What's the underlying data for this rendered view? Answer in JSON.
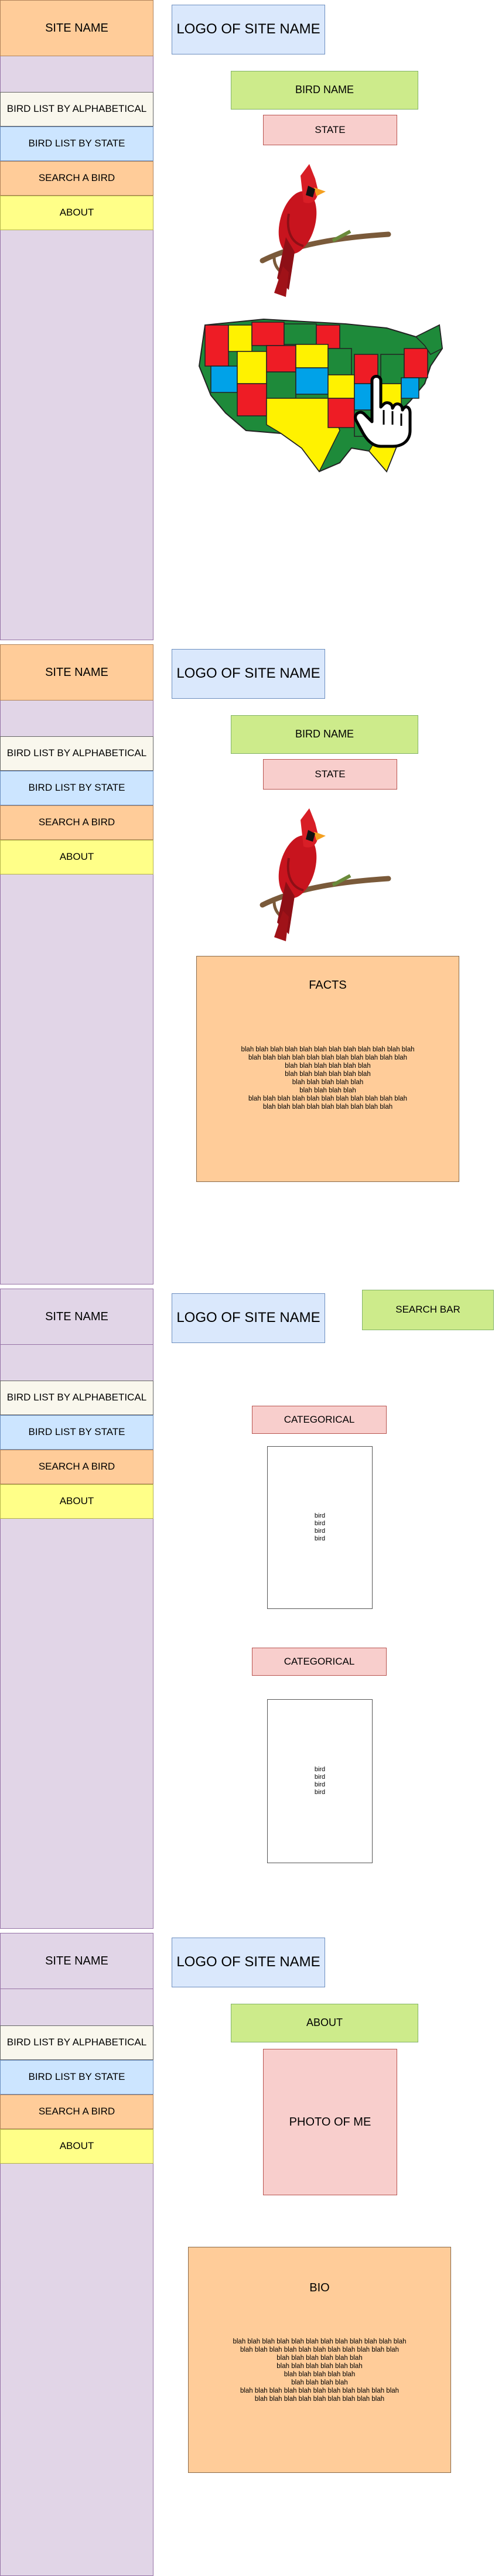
{
  "colors": {
    "sidebar": "#e1d5e7",
    "site_name_box": "#ffcc99",
    "logo_box": "#dae8fc",
    "green_box": "#cdeb8b",
    "pink_box": "#f8cecc",
    "facts_box": "#ffcc99"
  },
  "nav": {
    "alphabetical": "BIRD LIST BY ALPHABETICAL",
    "by_state": "BIRD LIST BY STATE",
    "search": "SEARCH A BIRD",
    "about": "ABOUT"
  },
  "site_name": "SITE NAME",
  "logo": "LOGO OF SITE NAME",
  "page1": {
    "bird_name": "BIRD NAME",
    "state": "STATE",
    "bird_image": "cardinal-icon",
    "map_image": "us-map-icon",
    "cursor": "hand-pointer-icon"
  },
  "page2": {
    "bird_name": "BIRD NAME",
    "state": "STATE",
    "facts_title": "FACTS",
    "facts_lines": [
      "blah blah blah blah blah blah blah blah blah blah blah blah",
      "blah blah blah blah blah blah blah blah blah blah blah",
      "blah blah blah blah blah blah",
      "blah blah blah blah blah blah",
      "blah blah blah blah blah",
      "blah blah blah blah",
      "blah blah blah blah blah blah blah blah blah blah blah",
      "blah blah blah blah blah blah blah blah blah"
    ]
  },
  "page3": {
    "search_bar": "SEARCH BAR",
    "categories": [
      {
        "label": "CATEGORICAL",
        "items": [
          "bird",
          "bird",
          "bird",
          "bird"
        ]
      },
      {
        "label": "CATEGORICAL",
        "items": [
          "bird",
          "bird",
          "bird",
          "bird"
        ]
      }
    ]
  },
  "page4": {
    "about": "ABOUT",
    "photo": "PHOTO OF ME",
    "bio_title": "BIO",
    "bio_lines": [
      "blah blah blah blah blah blah blah blah blah blah blah blah",
      "blah blah blah blah blah blah blah blah blah blah blah",
      "blah blah blah blah blah blah",
      "blah blah blah blah blah blah",
      "blah blah blah blah blah",
      "blah blah blah blah",
      "blah blah blah blah blah blah blah blah blah blah blah",
      "blah blah blah blah blah blah blah blah blah"
    ]
  }
}
